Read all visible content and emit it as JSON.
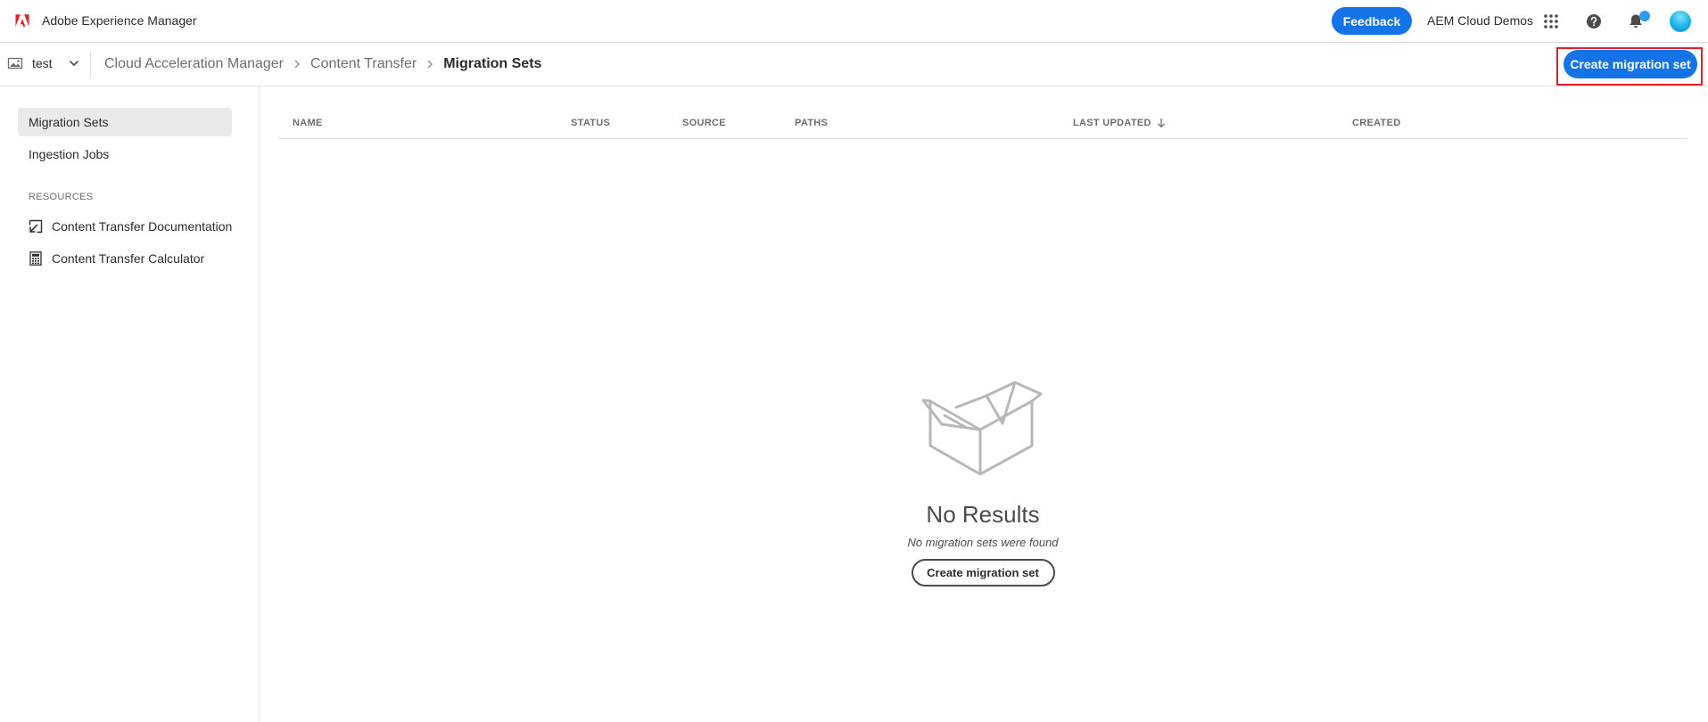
{
  "shell": {
    "app_title": "Adobe Experience Manager",
    "feedback_label": "Feedback",
    "org_name": "AEM Cloud Demos",
    "brand_color": "#e21f26",
    "accent_color": "#1473e6",
    "icons": [
      "adobe-logo-icon",
      "apps-grid-icon",
      "help-icon",
      "bell-icon",
      "avatar"
    ]
  },
  "actionbar": {
    "site_label": "test",
    "breadcrumb": [
      "Cloud Acceleration Manager",
      "Content Transfer",
      "Migration Sets"
    ],
    "create_label": "Create migration set"
  },
  "rail": {
    "items": [
      {
        "label": "Migration Sets",
        "selected": true
      },
      {
        "label": "Ingestion Jobs",
        "selected": false
      }
    ],
    "resources_heading": "RESOURCES",
    "links": [
      {
        "label": "Content Transfer Documentation",
        "icon": "external-link-icon"
      },
      {
        "label": "Content Transfer Calculator",
        "icon": "calculator-icon"
      }
    ]
  },
  "table": {
    "columns": [
      "NAME",
      "STATUS",
      "SOURCE",
      "PATHS",
      "LAST UPDATED",
      "CREATED"
    ],
    "sorted_column": "LAST UPDATED",
    "sort_direction": "descending"
  },
  "empty_state": {
    "title": "No Results",
    "description": "No migration sets were found",
    "button_label": "Create migration set"
  }
}
